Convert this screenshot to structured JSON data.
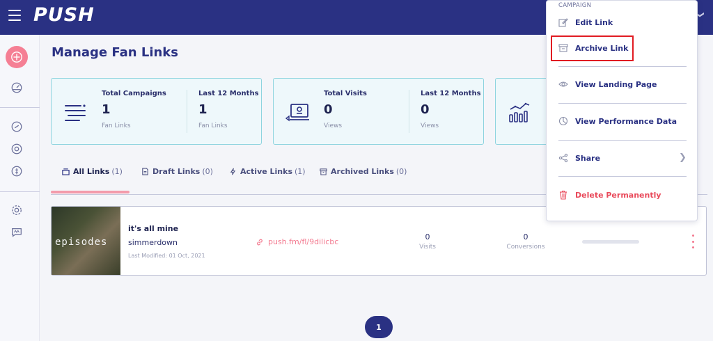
{
  "app": {
    "logo": "PUSH"
  },
  "page": {
    "title": "Manage Fan Links"
  },
  "stats": [
    {
      "label": "Total Campaigns",
      "value": "1",
      "sub": "Fan Links"
    },
    {
      "label": "Last 12 Months",
      "value": "1",
      "sub": "Fan Links"
    },
    {
      "label": "Total Visits",
      "value": "0",
      "sub": "Views"
    },
    {
      "label": "Last 12 Months",
      "value": "0",
      "sub": "Views"
    }
  ],
  "tabs": [
    {
      "label": "All Links",
      "count": "(1)"
    },
    {
      "label": "Draft Links",
      "count": "(0)"
    },
    {
      "label": "Active Links",
      "count": "(1)"
    },
    {
      "label": "Archived Links",
      "count": "(0)"
    }
  ],
  "link": {
    "thumb_text": "episodes",
    "title": "it's all mine",
    "artist": "simmerdown",
    "modified": "Last Modified: 01 Oct, 2021",
    "url": "push.fm/fl/9dilicbc",
    "visits_value": "0",
    "visits_label": "Visits",
    "conversions_value": "0",
    "conversions_label": "Conversions"
  },
  "pagination": {
    "current": "1"
  },
  "menu": {
    "section": "CAMPAIGN",
    "edit": "Edit Link",
    "archive": "Archive Link",
    "landing": "View Landing Page",
    "performance": "View Performance Data",
    "share": "Share",
    "delete": "Delete Permanently"
  },
  "colors": {
    "brand": "#2a3183",
    "accent": "#f3798f",
    "card_border": "#8ed4df",
    "danger": "#e94a5b"
  }
}
